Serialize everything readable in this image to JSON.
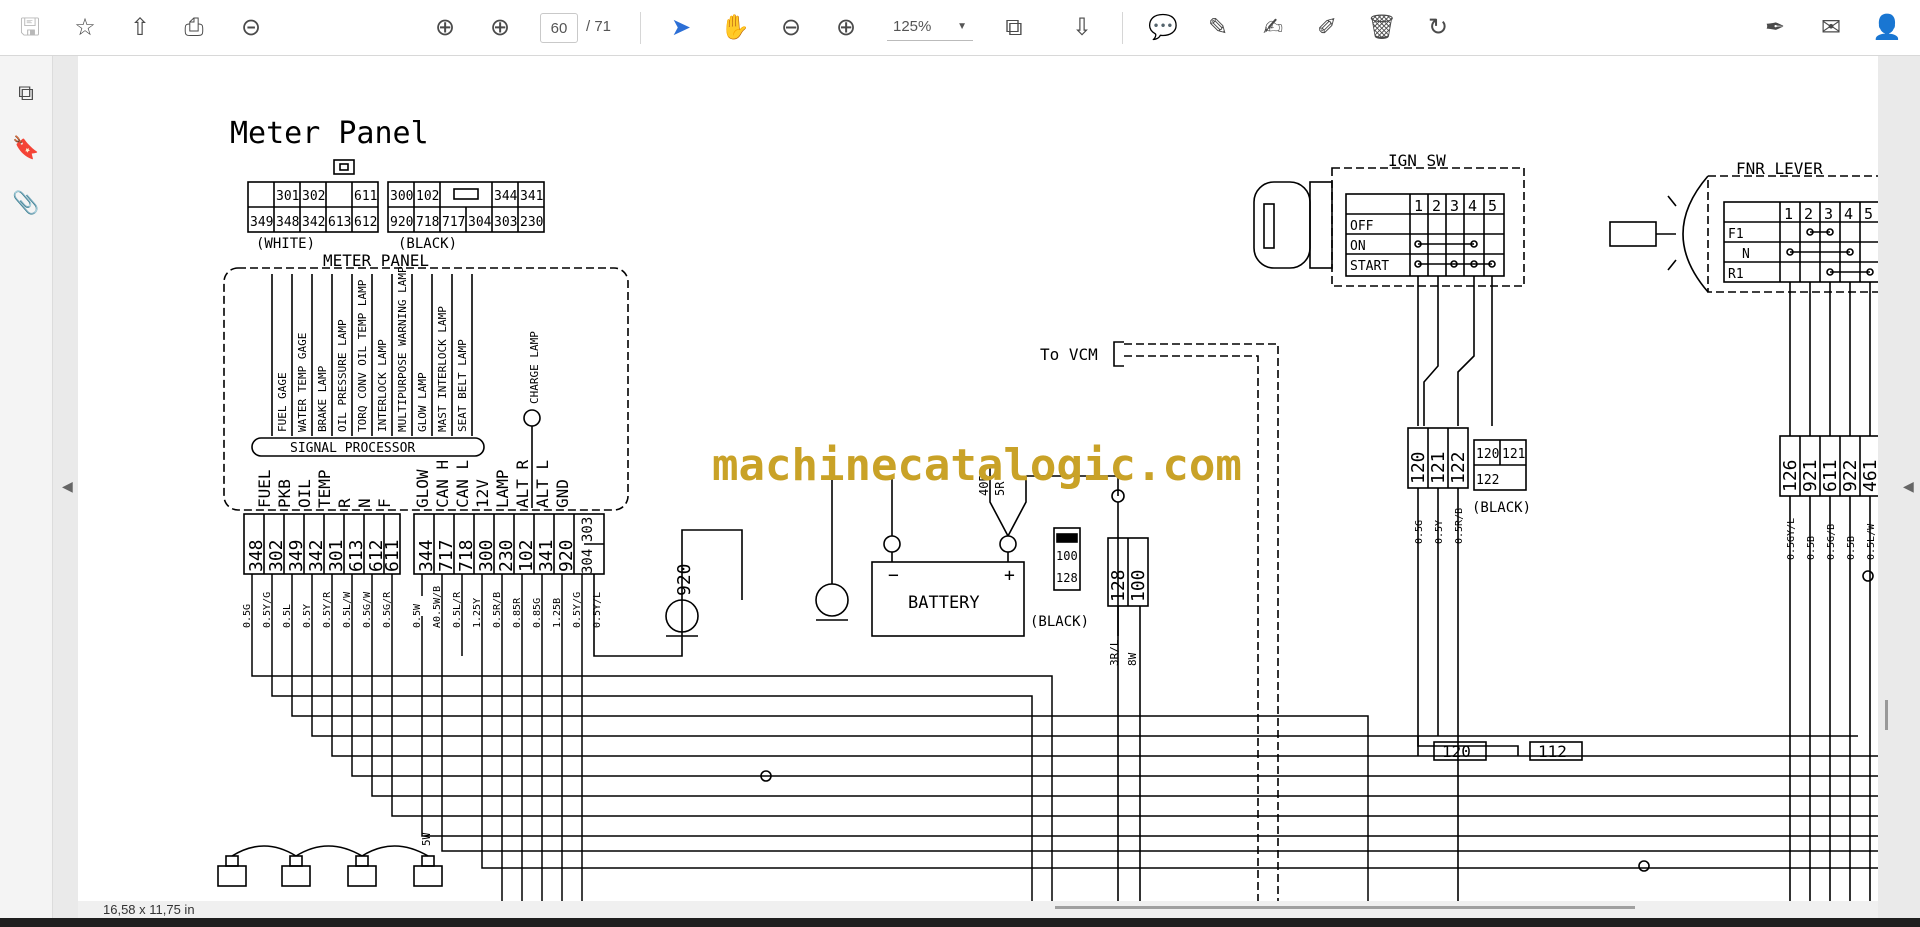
{
  "toolbar": {
    "current_page": "60",
    "total_pages": "/ 71",
    "zoom": "125%"
  },
  "status": {
    "dimensions": "16,58 x 11,75 in"
  },
  "document": {
    "title": "Meter Panel",
    "watermark": "machinecatalogic.com",
    "white_connector": {
      "row1": [
        "",
        "301",
        "302",
        "",
        "611"
      ],
      "row2": [
        "349",
        "348",
        "342",
        "613",
        "612"
      ],
      "label": "(WHITE)"
    },
    "black_connector": {
      "row1": [
        "300",
        "102",
        "",
        "344",
        "341"
      ],
      "row2": [
        "920",
        "718",
        "717",
        "304",
        "303",
        "230"
      ],
      "label": "(BLACK)"
    },
    "meter_panel_label": "METER PANEL",
    "lamp_labels": [
      "FUEL GAGE",
      "WATER TEMP GAGE",
      "BRAKE LAMP",
      "OIL PRESSURE LAMP",
      "TORQ CONV OIL TEMP LAMP",
      "INTERLOCK LAMP",
      "MULTIPURPOSE WARNING LAMP",
      "GLOW LAMP",
      "MAST INTERLOCK LAMP",
      "SEAT BELT LAMP"
    ],
    "charge_lamp": "CHARGE LAMP",
    "signal_processor": "SIGNAL PROCESSOR",
    "pin_labels_left": [
      "FUEL",
      "PKB",
      "OIL",
      "TEMP",
      "R",
      "N",
      "F"
    ],
    "pin_labels_right": [
      "GLOW",
      "CAN H",
      "CAN L",
      "12V",
      "LAMP",
      "ALT R",
      "ALT L",
      "GND"
    ],
    "pin_numbers_left": [
      "348",
      "302",
      "349",
      "342",
      "301",
      "613",
      "612",
      "611"
    ],
    "pin_numbers_right": [
      "344",
      "717",
      "718",
      "300",
      "230",
      "102",
      "341",
      "920",
      "303",
      "304"
    ],
    "wire_codes": [
      "0.5G",
      "0.5Y/G",
      "0.5L",
      "0.5Y",
      "0.5Y/R",
      "0.5L/W",
      "0.5G/W",
      "0.5G/R",
      "0.5W",
      "A0.5W/B",
      "0.5L/R",
      "1.25Y",
      "0.5R/B",
      "0.85R",
      "0.85G",
      "1.25B",
      "0.5Y/G",
      "0.5Y/L"
    ],
    "ground_920": "920",
    "battery": "BATTERY",
    "battery_minus": "−",
    "battery_plus": "+",
    "battery_wires": [
      "40B",
      "5R"
    ],
    "fuse_labels": [
      "100",
      "128"
    ],
    "fuse_pair": [
      "128",
      "100"
    ],
    "fuse_wires": [
      "3R/L",
      "8W"
    ],
    "black_label_1": "(BLACK)",
    "to_vcm": "To VCM",
    "ign_sw": {
      "title": "IGN SW",
      "columns": [
        "1",
        "2",
        "3",
        "4",
        "5"
      ],
      "rows": [
        "OFF",
        "ON",
        "START"
      ],
      "pins": [
        "120",
        "121",
        "122"
      ],
      "wires": [
        "0.5G",
        "0.5Y",
        "0.5R/B"
      ],
      "connector": [
        "120",
        "121",
        "122"
      ],
      "connector_label": "(BLACK)"
    },
    "fnr_lever": {
      "title": "FNR LEVER",
      "columns": [
        "1",
        "2",
        "3",
        "4",
        "5"
      ],
      "rows": [
        "F1",
        "N",
        "R1"
      ],
      "pins": [
        "126",
        "921",
        "611",
        "922",
        "461"
      ],
      "wires": [
        "0.5GY/L",
        "0.5B",
        "0.5G/B",
        "0.5B",
        "0.5L/W"
      ]
    },
    "bus_labels": [
      "120",
      "112"
    ],
    "wire_5w": "5W"
  }
}
